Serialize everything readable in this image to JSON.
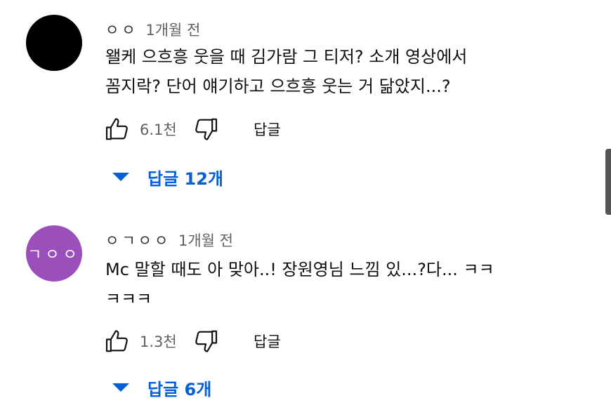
{
  "comments": [
    {
      "author": "ㅇㅇ",
      "time": "1개월 전",
      "avatar_color": "#000000",
      "avatar_initials": "",
      "text": "왤케 으흐흥 웃을 때 김가람 그 티저? 소개 영상에서\n꼼지락? 단어 얘기하고 으흐흥 웃는 거 닮았지...?",
      "likes": "6.1천",
      "reply_label": "답글",
      "replies_label": "답글 12개"
    },
    {
      "author": "ㅇㄱㅇㅇ",
      "time": "1개월 전",
      "avatar_color": "#9b4fba",
      "avatar_initials": "ㄱㅇㅇ",
      "text": "Mc 말할 때도 아 맞아..! 장원영님 느낌 있...?다... ㅋㅋ\nㅋㅋㅋ",
      "likes": "1.3천",
      "reply_label": "답글",
      "replies_label": "답글 6개"
    }
  ],
  "icons": {
    "like": "thumbs-up-icon",
    "dislike": "thumbs-down-icon",
    "expand": "triangle-down-icon"
  },
  "colors": {
    "link": "#065fd4",
    "secondary_text": "#606060"
  }
}
